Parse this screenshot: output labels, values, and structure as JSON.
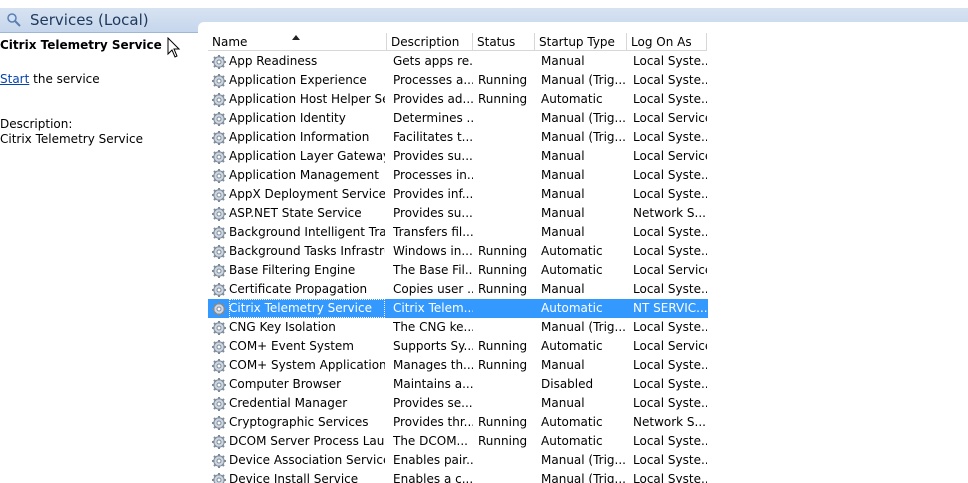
{
  "header": {
    "title": "Services (Local)"
  },
  "left_pane": {
    "service_title": "Citrix Telemetry Service",
    "start_link": "Start",
    "start_suffix": " the service",
    "description_label": "Description:",
    "description_text": "Citrix Telemetry Service"
  },
  "columns": [
    {
      "label": "Name"
    },
    {
      "label": "Description"
    },
    {
      "label": "Status"
    },
    {
      "label": "Startup Type"
    },
    {
      "label": "Log On As"
    }
  ],
  "sort": {
    "column": "Name",
    "direction": "ascending"
  },
  "selected_index": 13,
  "rows": [
    {
      "name": "App Readiness",
      "desc": "Gets apps re...",
      "status": "",
      "startup": "Manual",
      "logon": "Local Syste..."
    },
    {
      "name": "Application Experience",
      "desc": "Processes a...",
      "status": "Running",
      "startup": "Manual (Trig...",
      "logon": "Local Syste..."
    },
    {
      "name": "Application Host Helper Ser...",
      "desc": "Provides ad...",
      "status": "Running",
      "startup": "Automatic",
      "logon": "Local Syste..."
    },
    {
      "name": "Application Identity",
      "desc": "Determines ...",
      "status": "",
      "startup": "Manual (Trig...",
      "logon": "Local Service"
    },
    {
      "name": "Application Information",
      "desc": "Facilitates t...",
      "status": "",
      "startup": "Manual (Trig...",
      "logon": "Local Syste..."
    },
    {
      "name": "Application Layer Gateway ...",
      "desc": "Provides su...",
      "status": "",
      "startup": "Manual",
      "logon": "Local Service"
    },
    {
      "name": "Application Management",
      "desc": "Processes in...",
      "status": "",
      "startup": "Manual",
      "logon": "Local Syste..."
    },
    {
      "name": "AppX Deployment Service (...",
      "desc": "Provides inf...",
      "status": "",
      "startup": "Manual",
      "logon": "Local Syste..."
    },
    {
      "name": "ASP.NET State Service",
      "desc": "Provides su...",
      "status": "",
      "startup": "Manual",
      "logon": "Network S..."
    },
    {
      "name": "Background Intelligent Tran...",
      "desc": "Transfers fil...",
      "status": "",
      "startup": "Manual",
      "logon": "Local Syste..."
    },
    {
      "name": "Background Tasks Infrastru...",
      "desc": "Windows in...",
      "status": "Running",
      "startup": "Automatic",
      "logon": "Local Syste..."
    },
    {
      "name": "Base Filtering Engine",
      "desc": "The Base Fil...",
      "status": "Running",
      "startup": "Automatic",
      "logon": "Local Service"
    },
    {
      "name": "Certificate Propagation",
      "desc": "Copies user ...",
      "status": "Running",
      "startup": "Manual",
      "logon": "Local Syste..."
    },
    {
      "name": "Citrix Telemetry Service",
      "desc": "Citrix Telem...",
      "status": "",
      "startup": "Automatic",
      "logon": "NT SERVIC..."
    },
    {
      "name": "CNG Key Isolation",
      "desc": "The CNG ke...",
      "status": "",
      "startup": "Manual (Trig...",
      "logon": "Local Syste..."
    },
    {
      "name": "COM+ Event System",
      "desc": "Supports Sy...",
      "status": "Running",
      "startup": "Automatic",
      "logon": "Local Service"
    },
    {
      "name": "COM+ System Application",
      "desc": "Manages th...",
      "status": "Running",
      "startup": "Manual",
      "logon": "Local Syste..."
    },
    {
      "name": "Computer Browser",
      "desc": "Maintains a...",
      "status": "",
      "startup": "Disabled",
      "logon": "Local Syste..."
    },
    {
      "name": "Credential Manager",
      "desc": "Provides se...",
      "status": "",
      "startup": "Manual",
      "logon": "Local Syste..."
    },
    {
      "name": "Cryptographic Services",
      "desc": "Provides thr...",
      "status": "Running",
      "startup": "Automatic",
      "logon": "Network S..."
    },
    {
      "name": "DCOM Server Process Laun...",
      "desc": "The DCOM...",
      "status": "Running",
      "startup": "Automatic",
      "logon": "Local Syste..."
    },
    {
      "name": "Device Association Service",
      "desc": "Enables pair...",
      "status": "",
      "startup": "Manual (Trig...",
      "logon": "Local Syste..."
    },
    {
      "name": "Device Install Service",
      "desc": "Enables a c...",
      "status": "",
      "startup": "Manual (Trig...",
      "logon": "Local Syste..."
    }
  ]
}
